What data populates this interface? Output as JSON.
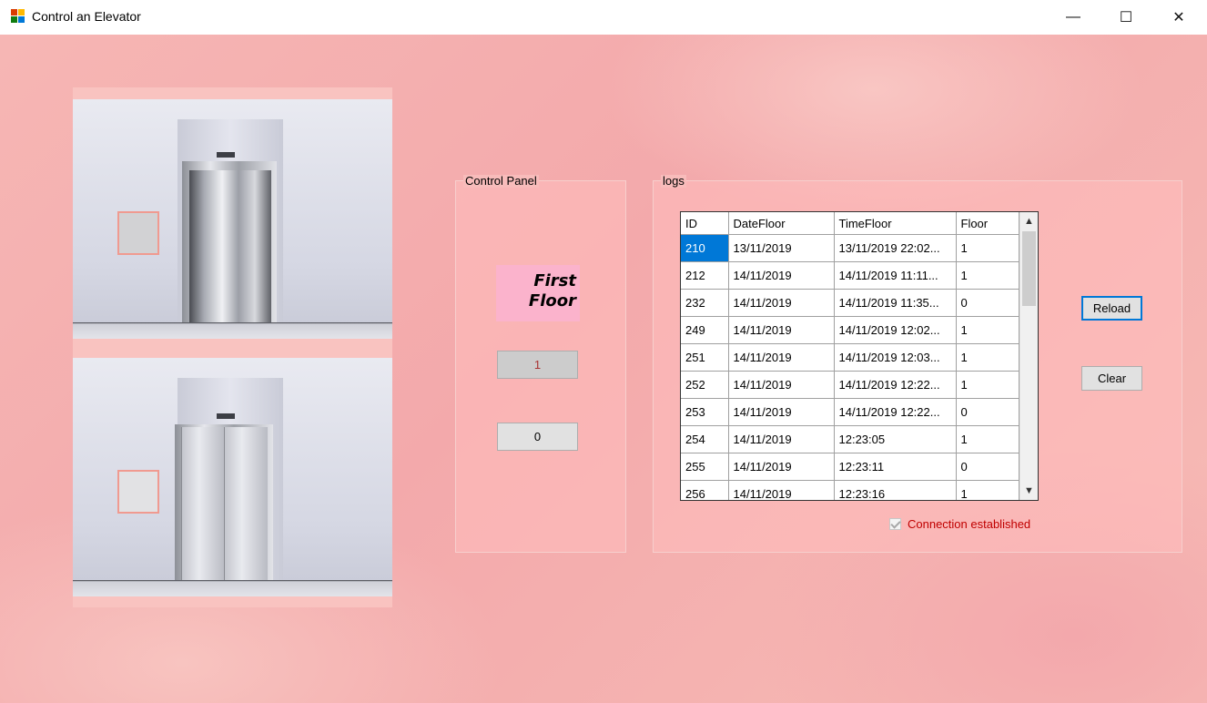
{
  "window": {
    "title": "Control an Elevator",
    "minimize": "—",
    "maximize": "☐",
    "close": "✕"
  },
  "control_panel": {
    "title": "Control Panel",
    "floor_line1": "First",
    "floor_line2": "Floor",
    "btn_first": "1",
    "btn_ground": "0"
  },
  "logs": {
    "title": "logs",
    "columns": [
      "ID",
      "DateFloor",
      "TimeFloor",
      "Floor"
    ],
    "rows": [
      [
        "210",
        "13/11/2019",
        "13/11/2019 22:02...",
        "1"
      ],
      [
        "212",
        "14/11/2019",
        "14/11/2019 11:11...",
        "1"
      ],
      [
        "232",
        "14/11/2019",
        "14/11/2019 11:35...",
        "0"
      ],
      [
        "249",
        "14/11/2019",
        "14/11/2019 12:02...",
        "1"
      ],
      [
        "251",
        "14/11/2019",
        "14/11/2019 12:03...",
        "1"
      ],
      [
        "252",
        "14/11/2019",
        "14/11/2019 12:22...",
        "1"
      ],
      [
        "253",
        "14/11/2019",
        "14/11/2019 12:22...",
        "0"
      ],
      [
        "254",
        "14/11/2019",
        "12:23:05",
        "1"
      ],
      [
        "255",
        "14/11/2019",
        "12:23:11",
        "0"
      ],
      [
        "256",
        "14/11/2019",
        "12:23:16",
        "1"
      ]
    ],
    "reload": "Reload",
    "clear": "Clear",
    "connection": "Connection established"
  },
  "scroll": {
    "up": "▲",
    "down": "▼"
  },
  "colors": {
    "selection": "#0078d7",
    "status_text": "#c00000",
    "floor_label_bg": "#fbb3cc"
  }
}
